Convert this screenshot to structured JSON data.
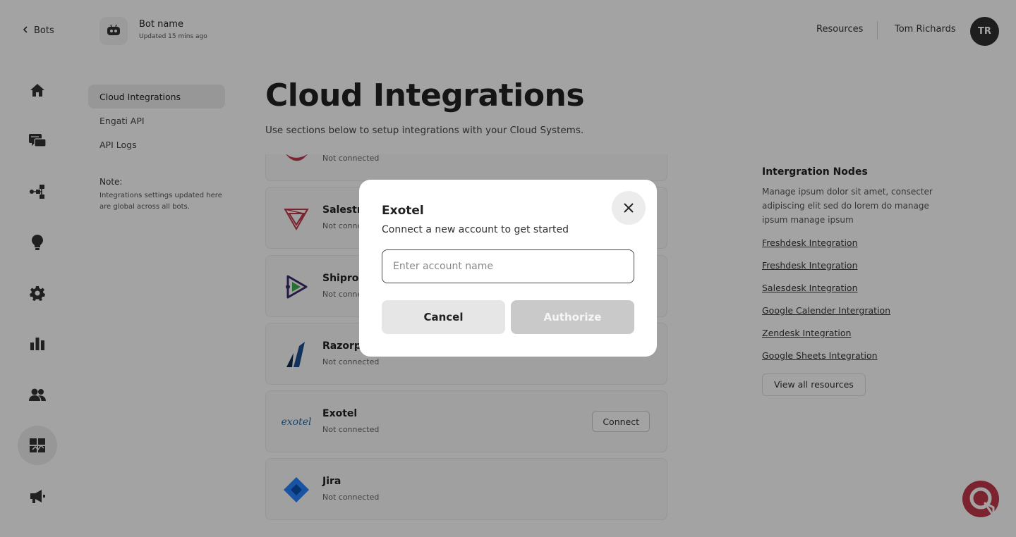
{
  "topbar": {
    "back_label": "Bots",
    "bot_name": "Bot name",
    "bot_updated": "Updated 15 mins ago",
    "resources_label": "Resources",
    "user_name": "Tom Richards",
    "user_initials": "TR"
  },
  "leftnav": {
    "items": [
      {
        "icon": "home-icon"
      },
      {
        "icon": "chat-icon"
      },
      {
        "icon": "flow-icon"
      },
      {
        "icon": "lightbulb-icon"
      },
      {
        "icon": "settings-icon"
      },
      {
        "icon": "analytics-icon"
      },
      {
        "icon": "users-icon"
      },
      {
        "icon": "integrations-icon",
        "active": true
      },
      {
        "icon": "broadcast-icon"
      }
    ]
  },
  "subnav": {
    "items": [
      {
        "label": "Cloud Integrations",
        "active": true
      },
      {
        "label": "Engati API"
      },
      {
        "label": "API Logs"
      }
    ],
    "note_title": "Note:",
    "note_text": "Integrations settings updated here are global across all bots."
  },
  "main": {
    "title": "Cloud Integrations",
    "subtitle": "Use sections below to setup integrations with your Cloud Systems.",
    "integrations": [
      {
        "name": "",
        "status": "Not connected",
        "logo": "partial-logo"
      },
      {
        "name": "Salestra",
        "status": "Not conne",
        "logo": "salesforce-logo"
      },
      {
        "name": "Shiproc",
        "status": "Not conne",
        "logo": "shiprocket-logo"
      },
      {
        "name": "Razorpa",
        "status": "Not connected",
        "logo": "razorpay-logo"
      },
      {
        "name": "Exotel",
        "status": "Not connected",
        "logo": "exotel-logo",
        "logo_text": "exotel",
        "action": "Connect"
      },
      {
        "name": "Jira",
        "status": "Not connected",
        "logo": "jira-logo"
      }
    ]
  },
  "resources_panel": {
    "title": "Intergration Nodes",
    "description": "Manage ipsum dolor sit amet, consecter adipiscing elit sed do lorem do manage ipsum manage ipsum",
    "links": [
      "Freshdesk Integration",
      "Freshdesk Integration",
      "Salesdesk Integration",
      "Google Calender Intergration",
      "Zendesk Integration",
      "Google Sheets Integration"
    ],
    "button": "View all resources"
  },
  "modal": {
    "title": "Exotel",
    "subtitle": "Connect a new account to get started",
    "input_placeholder": "Enter account name",
    "input_value": "",
    "cancel_label": "Cancel",
    "authorize_label": "Authorize"
  },
  "colors": {
    "accent": "#c0394b",
    "overlay": "rgba(0,0,0,0.36)",
    "help_fab": "#c0394b"
  }
}
